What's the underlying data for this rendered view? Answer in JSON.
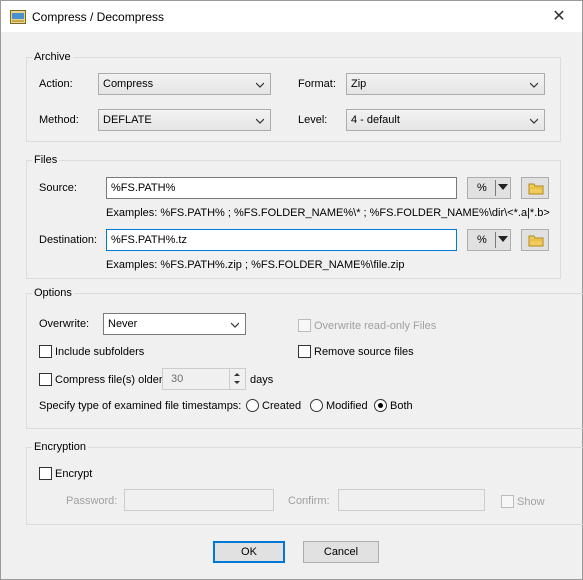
{
  "window": {
    "title": "Compress / Decompress",
    "close_symbol": "✕"
  },
  "archive": {
    "group_label": "Archive",
    "action_label": "Action:",
    "action_value": "Compress",
    "format_label": "Format:",
    "format_value": "Zip",
    "method_label": "Method:",
    "method_value": "DEFLATE",
    "level_label": "Level:",
    "level_value": "4 - default"
  },
  "files": {
    "group_label": "Files",
    "source_label": "Source:",
    "source_value": "%FS.PATH%",
    "source_examples": "Examples: %FS.PATH% ; %FS.FOLDER_NAME%\\* ; %FS.FOLDER_NAME%\\dir\\<*.a|*.b>",
    "destination_label": "Destination:",
    "destination_value": "%FS.PATH%.tz",
    "destination_examples": "Examples: %FS.PATH%.zip ; %FS.FOLDER_NAME%\\file.zip",
    "percent_button_label": "%"
  },
  "options": {
    "group_label": "Options",
    "overwrite_label": "Overwrite:",
    "overwrite_value": "Never",
    "overwrite_readonly_label": "Overwrite read-only Files",
    "include_subfolders_label": "Include subfolders",
    "remove_source_label": "Remove source files",
    "compress_older_label": "Compress file(s) older than",
    "days_value": "30",
    "days_label": "days",
    "timestamps_label": "Specify type of examined file timestamps:",
    "timestamp_created": "Created",
    "timestamp_modified": "Modified",
    "timestamp_both": "Both",
    "timestamp_selected": "Both"
  },
  "encryption": {
    "group_label": "Encryption",
    "encrypt_label": "Encrypt",
    "password_label": "Password:",
    "confirm_label": "Confirm:",
    "show_label": "Show"
  },
  "buttons": {
    "ok": "OK",
    "cancel": "Cancel"
  }
}
